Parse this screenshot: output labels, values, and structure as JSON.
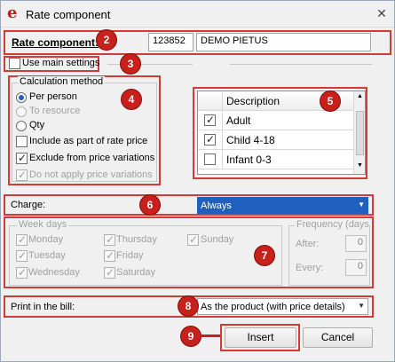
{
  "window": {
    "title": "Rate component",
    "close_icon": "close-icon"
  },
  "rate_component": {
    "label": "Rate component:",
    "code": "123852",
    "name": "DEMO PIETUS"
  },
  "use_main_settings": {
    "label": "Use main settings",
    "checked": false
  },
  "calculation_method": {
    "title": "Calculation method",
    "options": [
      "Per person",
      "To resource",
      "Qty"
    ],
    "selected": "Per person",
    "include_label": "Include as part of rate price",
    "exclude_label": "Exclude from price variations",
    "donot_label": "Do not apply price variations"
  },
  "description_grid": {
    "header": "Description",
    "rows": [
      {
        "label": "Adult",
        "checked": true
      },
      {
        "label": "Child 4-18",
        "checked": true
      },
      {
        "label": "Infant 0-3",
        "checked": false
      }
    ]
  },
  "charge": {
    "label": "Charge:",
    "value": "Always"
  },
  "week_days": {
    "title": "Week days",
    "days": [
      "Monday",
      "Tuesday",
      "Wednesday",
      "Thursday",
      "Friday",
      "Saturday",
      "Sunday"
    ]
  },
  "frequency": {
    "title": "Frequency (days)",
    "after_label": "After:",
    "after_value": "0",
    "every_label": "Every:",
    "every_value": "0"
  },
  "print_in_bill": {
    "label": "Print in the bill:",
    "value": "As the product (with price details)"
  },
  "buttons": {
    "insert": "Insert",
    "cancel": "Cancel"
  },
  "badges": [
    "2",
    "3",
    "4",
    "5",
    "6",
    "7",
    "8",
    "9"
  ],
  "colors": {
    "annotation_red": "#d23b36",
    "selection_blue": "#1f5fbf"
  }
}
